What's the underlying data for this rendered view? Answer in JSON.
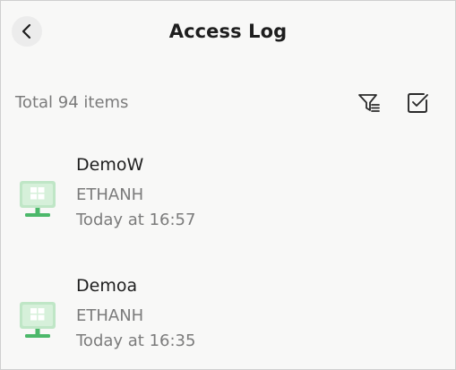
{
  "header": {
    "title": "Access Log",
    "back_icon": "chevron-left-icon"
  },
  "summary": {
    "total_text": "Total 94 items"
  },
  "toolbar": {
    "filter_icon": "filter-icon",
    "select_icon": "checkbox-icon"
  },
  "colors": {
    "background": "#f8f8f7",
    "title_text": "#1e1e1e",
    "secondary_text": "#7b7b7b",
    "device_icon_green": "#4cb86a",
    "device_icon_light": "#bfe6c6"
  },
  "items": [
    {
      "name": "DemoW",
      "user": "ETHANH",
      "time": "Today at 16:57",
      "icon": "windows-monitor-icon"
    },
    {
      "name": "Demoa",
      "user": "ETHANH",
      "time": "Today at 16:35",
      "icon": "windows-monitor-icon"
    }
  ]
}
